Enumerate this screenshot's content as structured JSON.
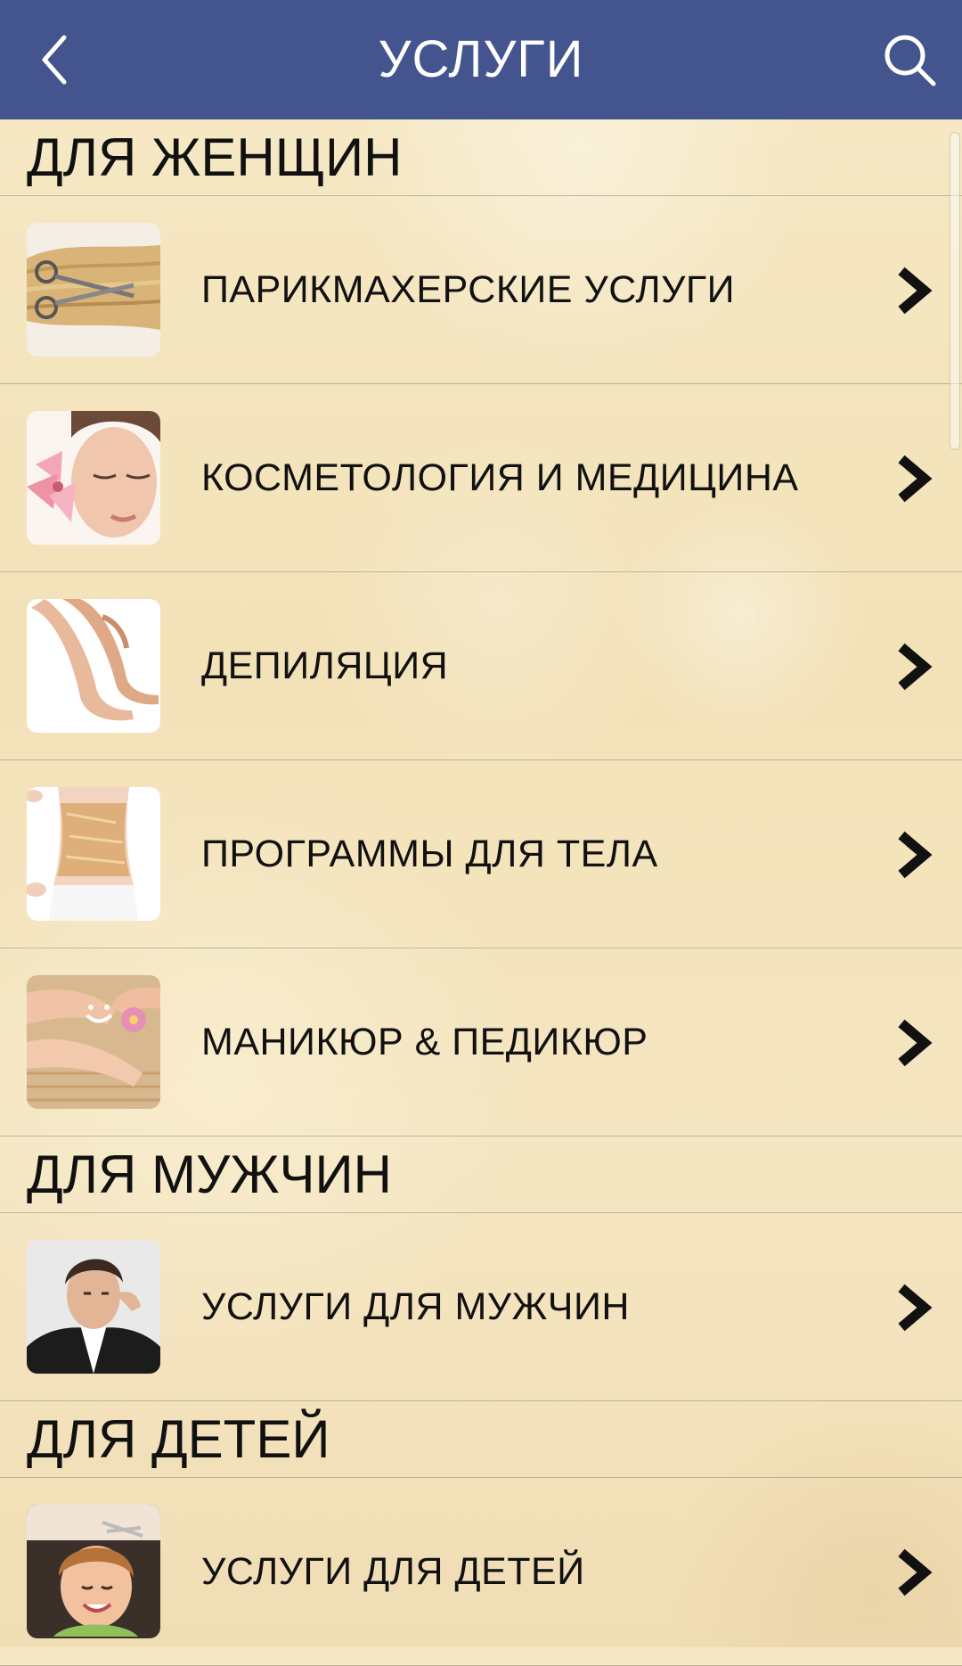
{
  "header": {
    "title": "УСЛУГИ",
    "back_icon": "chevron-left-icon",
    "search_icon": "search-icon"
  },
  "colors": {
    "header_bg": "#44548e",
    "text": "#111111"
  },
  "sections": [
    {
      "title": "ДЛЯ ЖЕНЩИН",
      "items": [
        {
          "label": "ПАРИКМАХЕРСКИЕ УСЛУГИ",
          "image": "hair-scissors-photo"
        },
        {
          "label": "КОСМЕТОЛОГИЯ И МЕДИЦИНА",
          "image": "face-lily-photo"
        },
        {
          "label": "ДЕПИЛЯЦИЯ",
          "image": "legs-photo"
        },
        {
          "label": "ПРОГРАММЫ ДЛЯ ТЕЛА",
          "image": "body-wrap-photo"
        },
        {
          "label": "МАНИКЮР & ПЕДИКЮР",
          "image": "manicure-pedicure-photo"
        }
      ]
    },
    {
      "title": "ДЛЯ МУЖЧИН",
      "items": [
        {
          "label": "УСЛУГИ ДЛЯ МУЖЧИН",
          "image": "man-haircut-photo"
        }
      ]
    },
    {
      "title": "ДЛЯ ДЕТЕЙ",
      "items": [
        {
          "label": "УСЛУГИ ДЛЯ ДЕТЕЙ",
          "image": "child-haircut-photo"
        }
      ]
    }
  ]
}
